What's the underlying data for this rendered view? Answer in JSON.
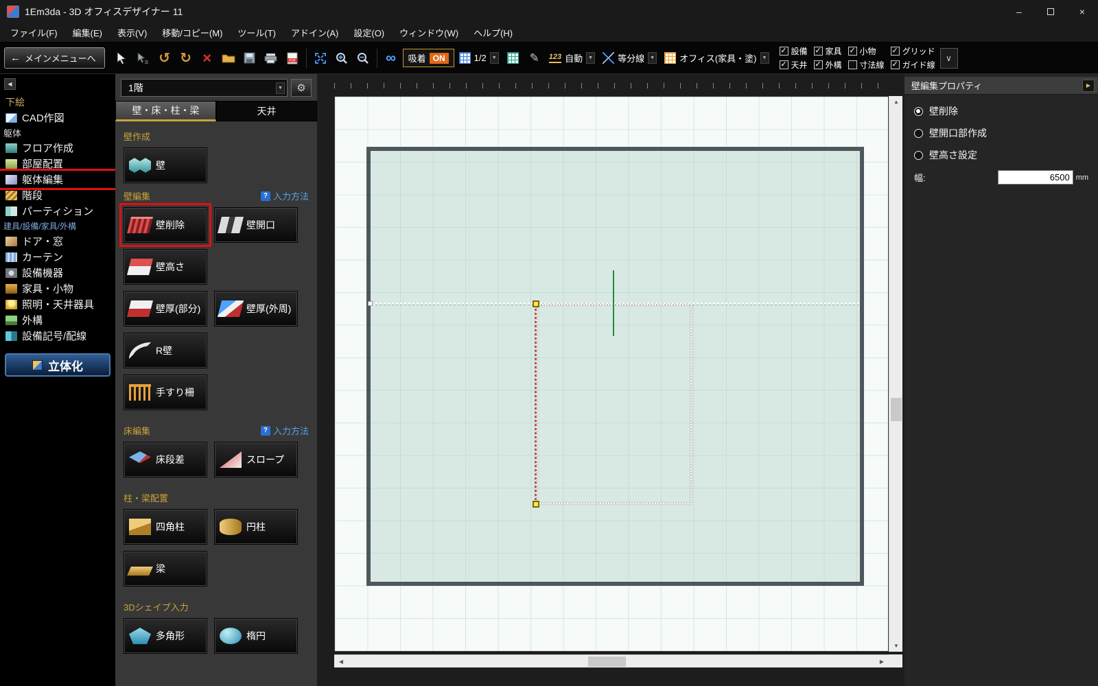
{
  "window": {
    "title": "1Em3da - 3D オフィスデザイナー 11"
  },
  "menubar": [
    "ファイル(F)",
    "編集(E)",
    "表示(V)",
    "移動/コピー(M)",
    "ツール(T)",
    "アドイン(A)",
    "設定(O)",
    "ウィンドウ(W)",
    "ヘルプ(H)"
  ],
  "toolbar": {
    "back": "メインメニューへ",
    "snap_label": "吸着",
    "snap_state": "ON",
    "grid_scale": "1/2",
    "auto_icon": "123",
    "auto_label": "自動",
    "divide_label": "等分線",
    "render_mode": "オフィス(家具・塗)",
    "layers": [
      {
        "label": "設備",
        "checked": true
      },
      {
        "label": "天井",
        "checked": true
      },
      {
        "label": "家具",
        "checked": true
      },
      {
        "label": "外構",
        "checked": true
      },
      {
        "label": "小物",
        "checked": true
      },
      {
        "label": "寸法線",
        "checked": false
      },
      {
        "label": "グリッド",
        "checked": true
      },
      {
        "label": "ガイド線",
        "checked": true
      }
    ]
  },
  "sidebar": {
    "sketch": "下絵",
    "cad": "CAD作図",
    "section_body": "躯体",
    "floor_create": "フロア作成",
    "room_layout": "部屋配置",
    "body_edit": "躯体編集",
    "stairs": "階段",
    "partition": "パーティション",
    "section_fixture": "建具/設備/家具/外構",
    "door_window": "ドア・窓",
    "curtain": "カーテン",
    "equipment": "設備機器",
    "furniture": "家具・小物",
    "lighting": "照明・天井器具",
    "exterior": "外構",
    "symbols": "設備記号/配線",
    "solidify": "立体化"
  },
  "tool_panel": {
    "floor": "1階",
    "tabs": [
      "壁・床・柱・梁",
      "天井"
    ],
    "help_link": "入力方法",
    "sections": {
      "wall_create": "壁作成",
      "wall_edit": "壁編集",
      "floor_edit": "床編集",
      "column_beam": "柱・梁配置",
      "shape3d": "3Dシェイプ入力"
    },
    "buttons": {
      "wall": "壁",
      "wall_delete": "壁削除",
      "wall_opening": "壁開口",
      "wall_height": "壁高さ",
      "wall_thickness_part": "壁厚(部分)",
      "wall_thickness_outer": "壁厚(外周)",
      "r_wall": "R壁",
      "handrail": "手すり柵",
      "floor_step": "床段差",
      "slope": "スロープ",
      "square_column": "四角柱",
      "cylinder": "円柱",
      "beam": "梁",
      "polygon": "多角形",
      "ellipse": "楕円"
    }
  },
  "properties": {
    "title": "壁編集プロパティ",
    "options": [
      {
        "label": "壁削除",
        "selected": true
      },
      {
        "label": "壁開口部作成",
        "selected": false
      },
      {
        "label": "壁高さ設定",
        "selected": false
      }
    ],
    "width_label": "幅:",
    "width_value": "6500",
    "width_unit": "mm"
  },
  "icons": {
    "back_arrow": "←",
    "dropdown": "▼",
    "check": "✓",
    "collapse_left": "◀",
    "collapse_right": "▶",
    "undo": "↺",
    "redo": "↻",
    "delete": "×",
    "infinity": "∞",
    "gear": "⚙",
    "pen": "✎",
    "chevron_down": "∨",
    "minimize": "–",
    "close": "×",
    "scroll_up": "▲",
    "scroll_down": "▼",
    "scroll_left": "◀",
    "scroll_right": "▶",
    "help": "?",
    "pdf_label": "PDF"
  }
}
